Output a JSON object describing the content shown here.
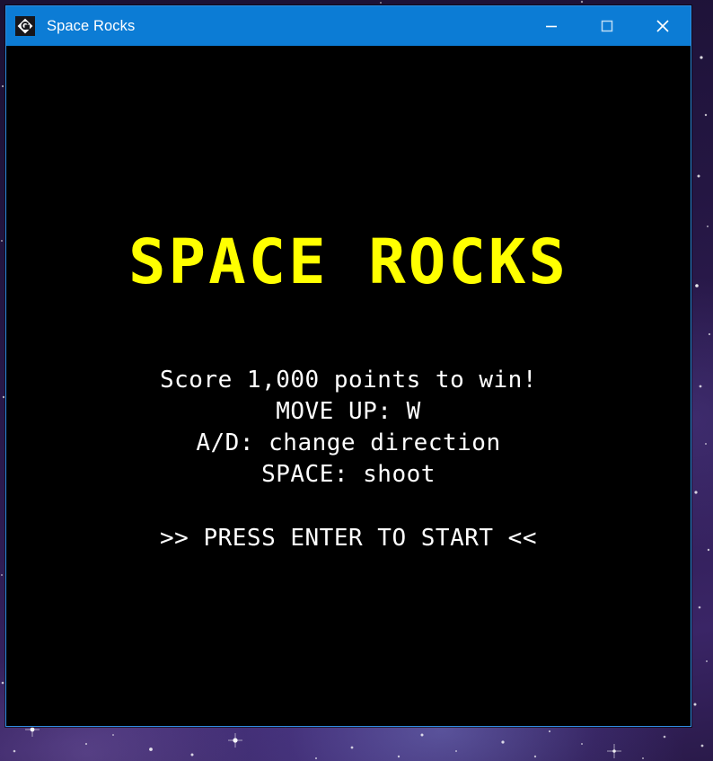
{
  "window": {
    "title": "Space Rocks",
    "icon": "gamemaker-logo-icon",
    "border_color": "#2f8ce0",
    "titlebar_color": "#0c7cd5",
    "controls": {
      "minimize_label": "Minimize",
      "maximize_label": "Maximize",
      "close_label": "Close"
    }
  },
  "desktop": {
    "wallpaper": "purple-nebula-starfield"
  },
  "game": {
    "title": "SPACE ROCKS",
    "title_color": "#ffff00",
    "background_color": "#000000",
    "text_color": "#ffffff",
    "instructions": [
      "Score 1,000 points to win!",
      "MOVE UP: W",
      "A/D: change direction",
      "SPACE: shoot"
    ],
    "instructions_block": "Score 1,000 points to win!\nMOVE UP: W\nA/D: change direction\nSPACE: shoot",
    "start_prompt": ">> PRESS ENTER TO START <<",
    "win_score": "1,000"
  }
}
